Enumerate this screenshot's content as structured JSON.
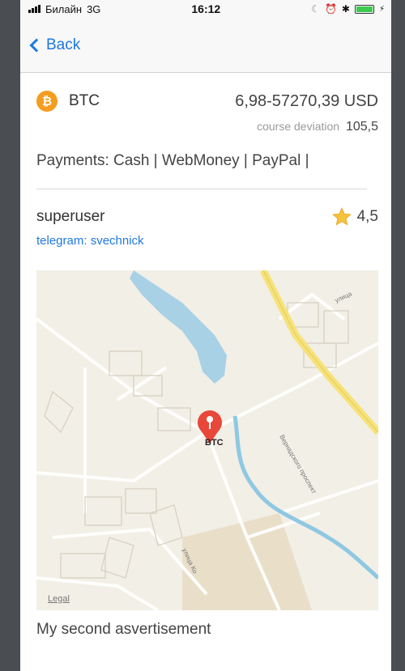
{
  "status_bar": {
    "carrier": "Билайн",
    "network": "3G",
    "time": "16:12",
    "battery_level": 1.0
  },
  "nav": {
    "back_label": "Back"
  },
  "listing": {
    "coin": "BTC",
    "price_range": "6,98-57270,39 USD",
    "deviation_label": "course deviation",
    "deviation_value": "105,5",
    "payments": "Payments: Cash | WebMoney | PayPal |",
    "user": "superuser",
    "rating": "4,5",
    "telegram": "telegram: svechnick"
  },
  "map": {
    "pin_label": "BTC",
    "legal": "Legal",
    "street_1": "улица",
    "street_2": "Вернадского проспект",
    "street_3": "улица Ко"
  },
  "description": "My second asvertisement",
  "colors": {
    "accent": "#1f78e0",
    "bitcoin": "#f59d1f",
    "pin": "#e8473a",
    "water": "#a8d1e6",
    "road_major": "#f6e27a"
  }
}
